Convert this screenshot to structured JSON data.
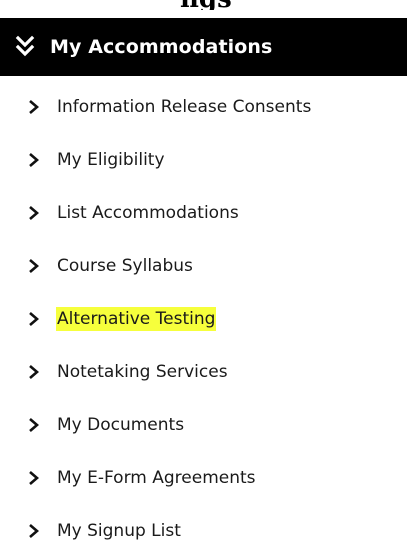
{
  "page_heading": "ngs",
  "header": {
    "title": "My Accommodations",
    "icon": "double-chevron-down-icon"
  },
  "menu": {
    "items": [
      {
        "label": "Information Release Consents",
        "icon": "chevron-right-icon",
        "highlighted": false
      },
      {
        "label": "My Eligibility",
        "icon": "chevron-right-icon",
        "highlighted": false
      },
      {
        "label": "List Accommodations",
        "icon": "chevron-right-icon",
        "highlighted": false
      },
      {
        "label": "Course Syllabus",
        "icon": "chevron-right-icon",
        "highlighted": false
      },
      {
        "label": "Alternative Testing",
        "icon": "chevron-right-icon",
        "highlighted": true
      },
      {
        "label": "Notetaking Services",
        "icon": "chevron-right-icon",
        "highlighted": false
      },
      {
        "label": "My Documents",
        "icon": "chevron-right-icon",
        "highlighted": false
      },
      {
        "label": "My E-Form Agreements",
        "icon": "chevron-right-icon",
        "highlighted": false
      },
      {
        "label": "My Signup List",
        "icon": "chevron-right-icon",
        "highlighted": false
      }
    ]
  },
  "colors": {
    "header_background": "#000000",
    "header_text": "#ffffff",
    "highlight": "#f6ff3c",
    "item_text": "#1a1a1a"
  }
}
